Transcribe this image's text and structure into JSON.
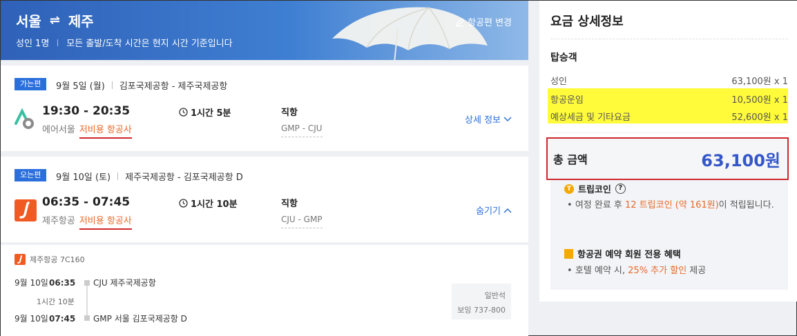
{
  "header": {
    "origin": "서울",
    "destination": "제주",
    "passengers": "성인 1명",
    "time_notice": "모든 출발/도착 시간은 현지 시간 기준입니다",
    "change_flight": "항공편 변경"
  },
  "outbound": {
    "tag": "가는편",
    "date": "9월 5일 (월)",
    "route": "김포국제공항 - 제주국제공항",
    "times": "19:30 - 20:35",
    "airline": "에어서울",
    "lcc_label": "저비용 항공사",
    "duration": "1시간 5분",
    "direct": "직항",
    "codes": "GMP - CJU",
    "toggle": "상세 정보"
  },
  "return": {
    "tag": "오는편",
    "date": "9월 10일 (토)",
    "route": "제주국제공항 - 김포국제공항 D",
    "times": "06:35 - 07:45",
    "airline": "제주항공",
    "lcc_label": "저비용 항공사",
    "duration": "1시간 10분",
    "direct": "직항",
    "codes": "CJU - GMP",
    "toggle": "숨기기"
  },
  "segment": {
    "flight": "제주항공 7C160",
    "dep_date": "9월 10일",
    "dep_time": "06:35",
    "dep_airport": "CJU 제주국제공항",
    "duration": "1시간 10분",
    "arr_date": "9월 10일",
    "arr_time": "07:45",
    "arr_airport": "GMP 서울 김포국제공항 D",
    "cabin": "일반석",
    "aircraft": "보잉 737-800"
  },
  "fare": {
    "title": "요금 상세정보",
    "pax_title": "탑승객",
    "rows": [
      {
        "label": "성인",
        "value": "63,100원 x 1"
      },
      {
        "label": "항공운임",
        "value": "10,500원 x 1"
      },
      {
        "label": "예상세금 및 기타요금",
        "value": "52,600원 x 1"
      }
    ],
    "total_label": "총 금액",
    "total_amount": "63,100원"
  },
  "tripcoin": {
    "title": "트립코인",
    "text_pre": "여정 완료 후 ",
    "text_highlight": "12 트립코인 (약 161원)",
    "text_post": "이 적립됩니다."
  },
  "member": {
    "title": "항공권 예약 회원 전용 혜택",
    "text_pre": "호텔 예약 시, ",
    "text_highlight": "25% 추가 할인",
    "text_post": " 제공"
  },
  "colors": {
    "accent": "#2a6fdb",
    "lcc": "#e8692a",
    "highlight": "#fffb3a",
    "total": "#3456c8",
    "annotation_red": "#d0262d"
  }
}
